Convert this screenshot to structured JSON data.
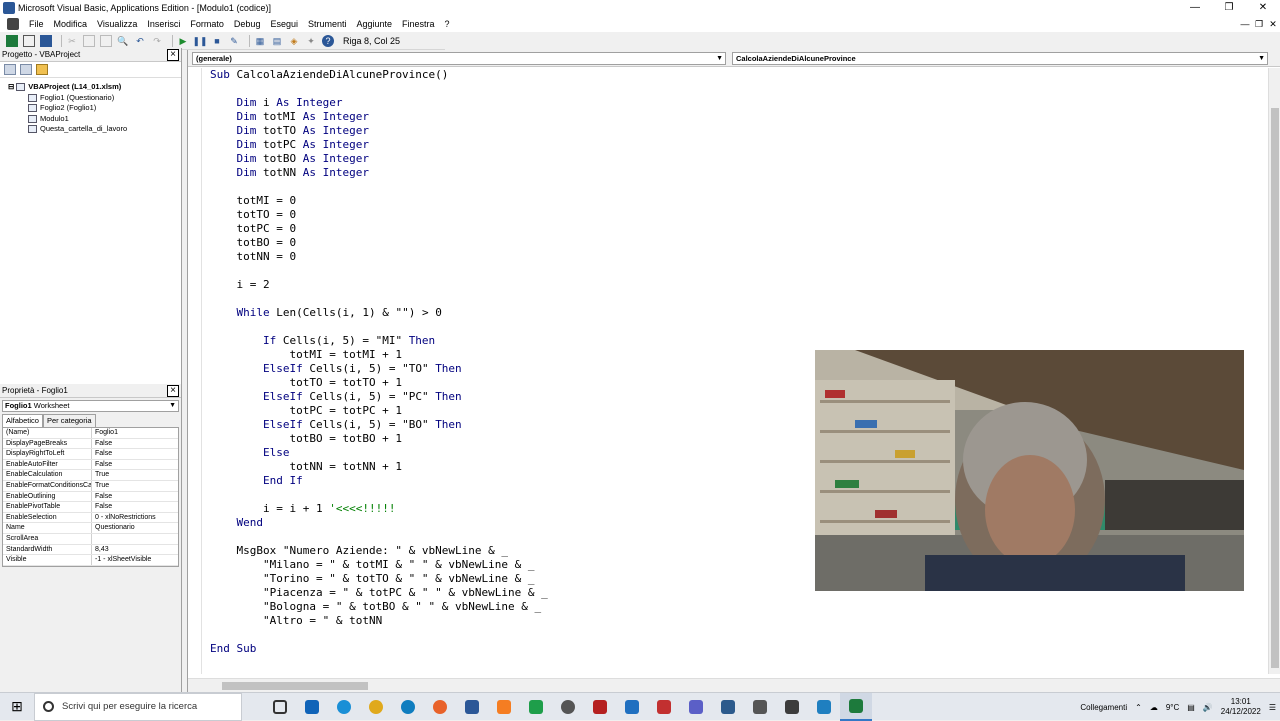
{
  "window": {
    "title": "Microsoft Visual Basic, Applications Edition - [Modulo1 (codice)]"
  },
  "menu": [
    "File",
    "Modifica",
    "Visualizza",
    "Inserisci",
    "Formato",
    "Debug",
    "Esegui",
    "Strumenti",
    "Aggiunte",
    "Finestra",
    "?"
  ],
  "toolbar": {
    "cursor_position": "Riga 8, Col 25"
  },
  "project": {
    "title": "Progetto - VBAProject",
    "root": "VBAProject (L14_01.xlsm)",
    "items": [
      "Foglio1 (Questionario)",
      "Foglio2 (Foglio1)",
      "Modulo1",
      "Questa_cartella_di_lavoro"
    ]
  },
  "properties": {
    "title": "Proprietà - Foglio1",
    "object_name": "Foglio1",
    "object_type": "Worksheet",
    "tabs": [
      "Alfabetico",
      "Per categoria"
    ],
    "rows": [
      {
        "name": "(Name)",
        "value": "Foglio1"
      },
      {
        "name": "DisplayPageBreaks",
        "value": "False"
      },
      {
        "name": "DisplayRightToLeft",
        "value": "False"
      },
      {
        "name": "EnableAutoFilter",
        "value": "False"
      },
      {
        "name": "EnableCalculation",
        "value": "True"
      },
      {
        "name": "EnableFormatConditionsCal",
        "value": "True"
      },
      {
        "name": "EnableOutlining",
        "value": "False"
      },
      {
        "name": "EnablePivotTable",
        "value": "False"
      },
      {
        "name": "EnableSelection",
        "value": "0 - xlNoRestrictions"
      },
      {
        "name": "Name",
        "value": "Questionario"
      },
      {
        "name": "ScrollArea",
        "value": ""
      },
      {
        "name": "StandardWidth",
        "value": "8,43"
      },
      {
        "name": "Visible",
        "value": "-1 - xlSheetVisible"
      }
    ]
  },
  "editor": {
    "object_combo": "(generale)",
    "proc_combo": "CalcolaAziendeDiAlcuneProvince",
    "code_lines": [
      "Sub CalcolaAziendeDiAlcuneProvince()",
      "",
      "    Dim i As Integer",
      "    Dim totMI As Integer",
      "    Dim totTO As Integer",
      "    Dim totPC As Integer",
      "    Dim totBO As Integer",
      "    Dim totNN As Integer",
      "",
      "    totMI = 0",
      "    totTO = 0",
      "    totPC = 0",
      "    totBO = 0",
      "    totNN = 0",
      "",
      "    i = 2",
      "",
      "    While Len(Cells(i, 1) & \"\") > 0",
      "",
      "        If Cells(i, 5) = \"MI\" Then",
      "            totMI = totMI + 1",
      "        ElseIf Cells(i, 5) = \"TO\" Then",
      "            totTO = totTO + 1",
      "        ElseIf Cells(i, 5) = \"PC\" Then",
      "            totPC = totPC + 1",
      "        ElseIf Cells(i, 5) = \"BO\" Then",
      "            totBO = totBO + 1",
      "        Else",
      "            totNN = totNN + 1",
      "        End If",
      "",
      "        i = i + 1 '<<<<!!!!!",
      "    Wend",
      "",
      "    MsgBox \"Numero Aziende: \" & vbNewLine & _",
      "        \"Milano = \" & totMI & \" \" & vbNewLine & _",
      "        \"Torino = \" & totTO & \" \" & vbNewLine & _",
      "        \"Piacenza = \" & totPC & \" \" & vbNewLine & _",
      "        \"Bologna = \" & totBO & \" \" & vbNewLine & _",
      "        \"Altro = \" & totNN",
      "",
      "End Sub"
    ]
  },
  "taskbar": {
    "search_placeholder": "Scrivi qui per eseguire la ricerca",
    "tray_label": "Collegamenti",
    "weather": "9°C",
    "time": "13:01",
    "date": "24/12/2022"
  }
}
